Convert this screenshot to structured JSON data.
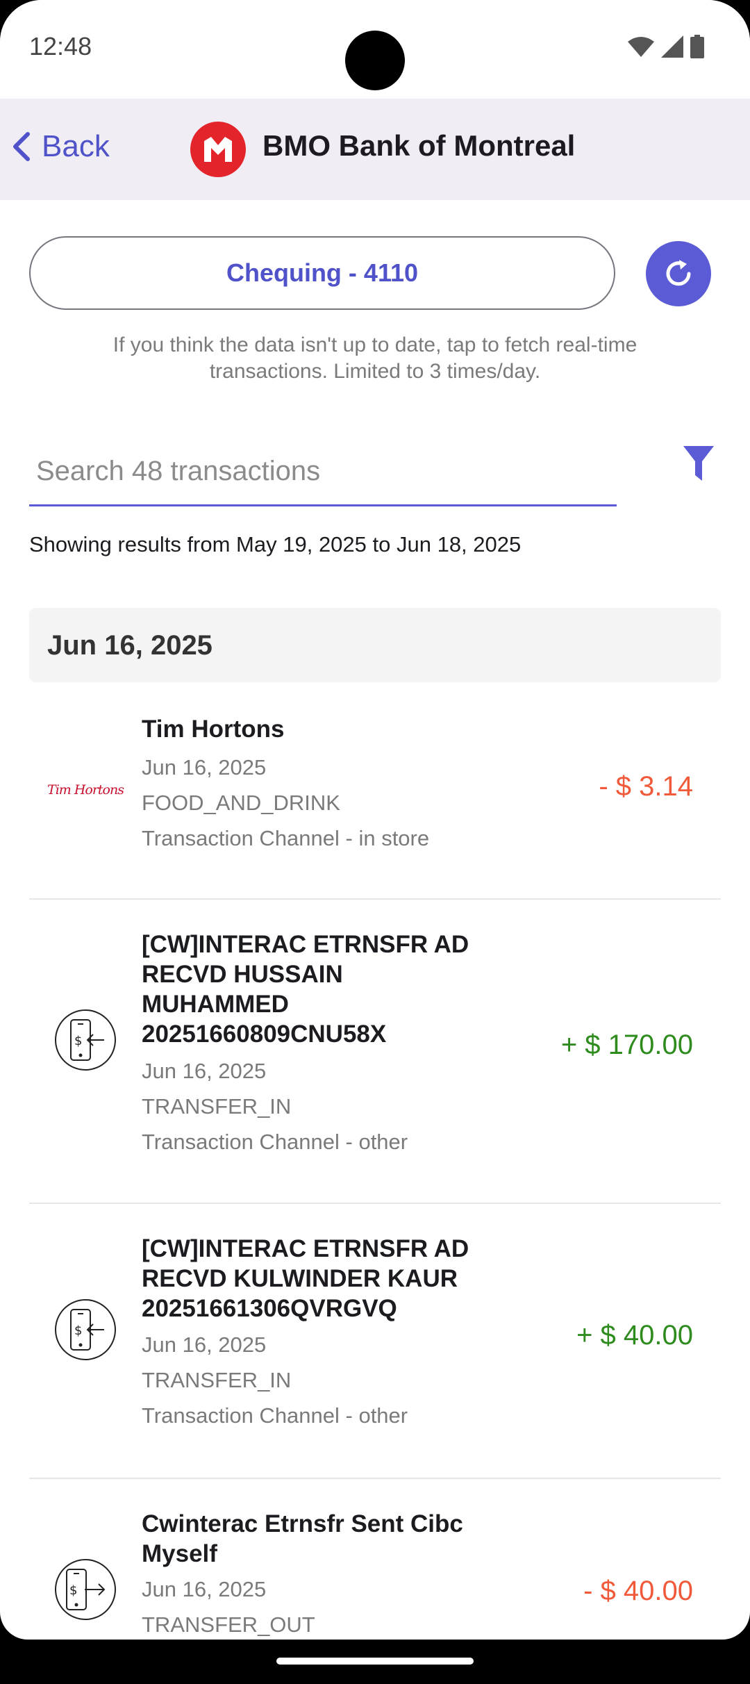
{
  "status": {
    "time": "12:48"
  },
  "header": {
    "back_label": "Back",
    "bank_name": "BMO Bank of Montreal"
  },
  "account": {
    "label": "Chequing - 4110"
  },
  "hint": "If you think the data isn't up to date, tap to fetch real-time transactions. Limited to 3 times/day.",
  "search": {
    "placeholder": "Search 48 transactions",
    "value": ""
  },
  "range_text": "Showing results from May 19, 2025 to Jun 18, 2025",
  "date_group": "Jun 16, 2025",
  "transactions": [
    {
      "merchant": "Tim Hortons",
      "logo_text": "Tim Hortons",
      "date": "Jun 16, 2025",
      "category": "FOOD_AND_DRINK",
      "channel": "Transaction Channel - in store",
      "amount": "- $ 3.14",
      "icon": "tim-hortons-logo"
    },
    {
      "merchant": "[CW]INTERAC ETRNSFR AD RECVD HUSSAIN MUHAMMED 20251660809CNU58X",
      "date": "Jun 16, 2025",
      "category": "TRANSFER_IN",
      "channel": "Transaction Channel - other",
      "amount": "+ $ 170.00",
      "icon": "transfer-in-icon"
    },
    {
      "merchant": "[CW]INTERAC ETRNSFR AD RECVD KULWINDER KAUR 20251661306QVRGVQ",
      "date": "Jun 16, 2025",
      "category": "TRANSFER_IN",
      "channel": "Transaction Channel - other",
      "amount": "+ $ 40.00",
      "icon": "transfer-in-icon"
    },
    {
      "merchant": "Cwinterac Etrnsfr Sent Cibc Myself",
      "date": "Jun 16, 2025",
      "category": "TRANSFER_OUT",
      "amount": "- $ 40.00",
      "icon": "transfer-out-icon"
    }
  ],
  "colors": {
    "accent": "#5b5bd6",
    "negative": "#f05a3a",
    "positive": "#2e8b1e",
    "bmo_red": "#e3242b"
  }
}
